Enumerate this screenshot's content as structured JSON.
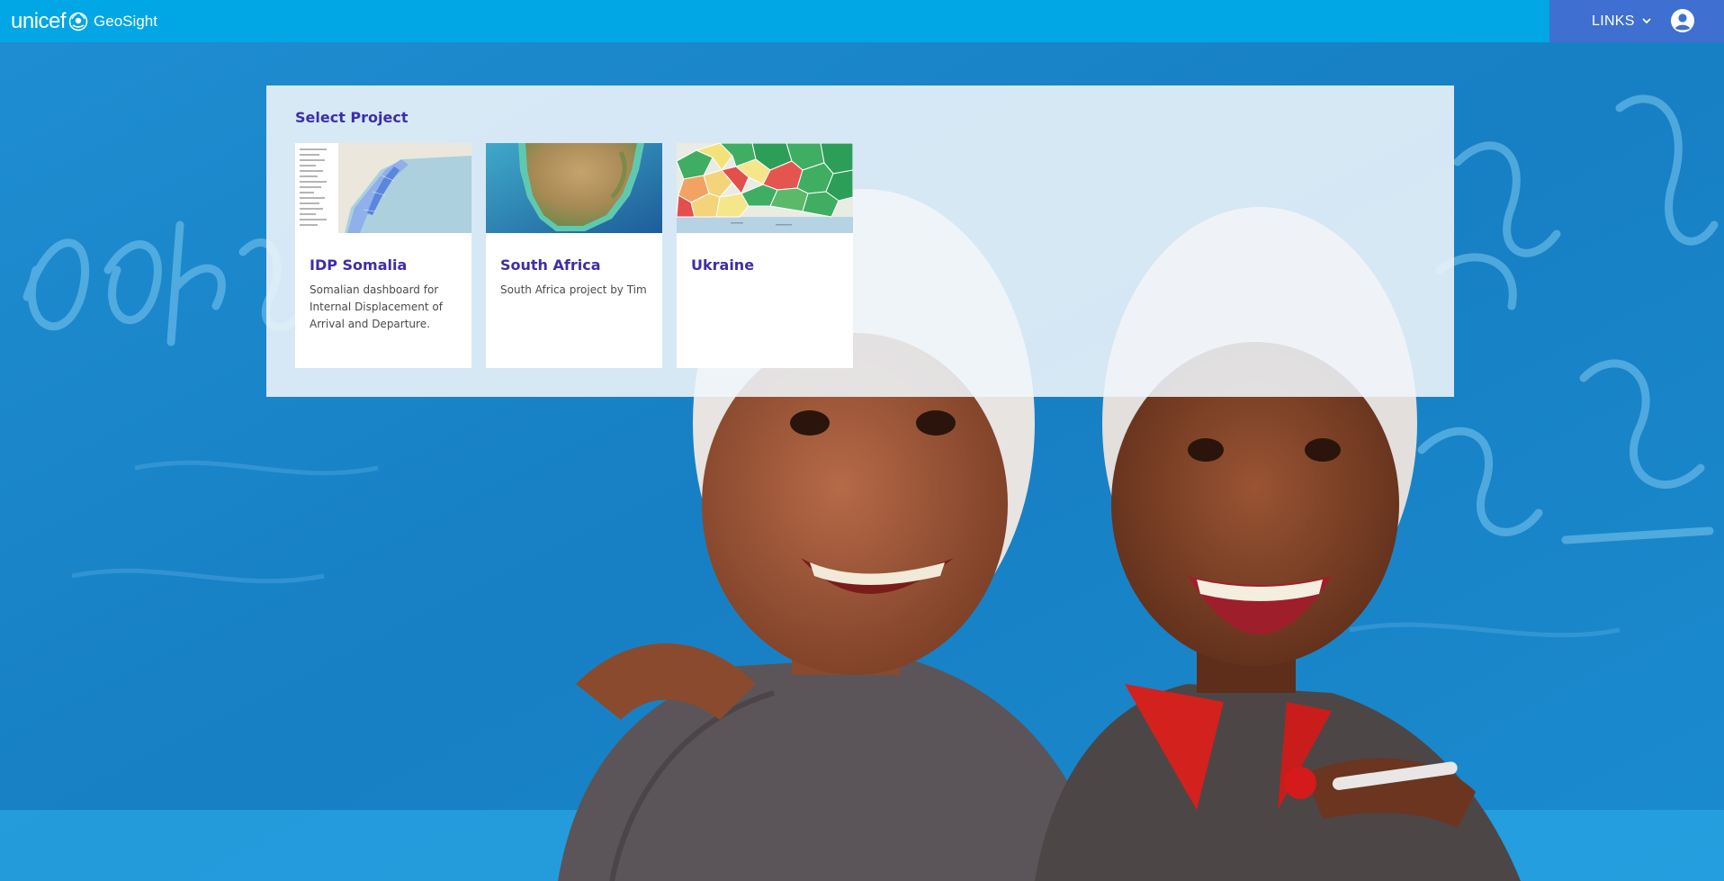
{
  "header": {
    "brand_word": "unicef",
    "app_name": "GeoSight",
    "links_label": "LINKS",
    "icons": {
      "emblem": "unicef-emblem-icon",
      "dropdown": "chevron-down-icon",
      "account": "account-circle-icon"
    }
  },
  "project_panel": {
    "title": "Select Project",
    "projects": [
      {
        "name": "IDP Somalia",
        "description": "Somalian dashboard for Internal Displacement of Arrival and Departure."
      },
      {
        "name": "South Africa",
        "description": "South Africa project by Tim"
      },
      {
        "name": "Ukraine",
        "description": ""
      }
    ]
  },
  "colors": {
    "header_bg": "#00a7e4",
    "links_bg": "#3f6fd1",
    "accent_text": "#3d2ea8",
    "panel_bg": "#f0f6fa"
  }
}
